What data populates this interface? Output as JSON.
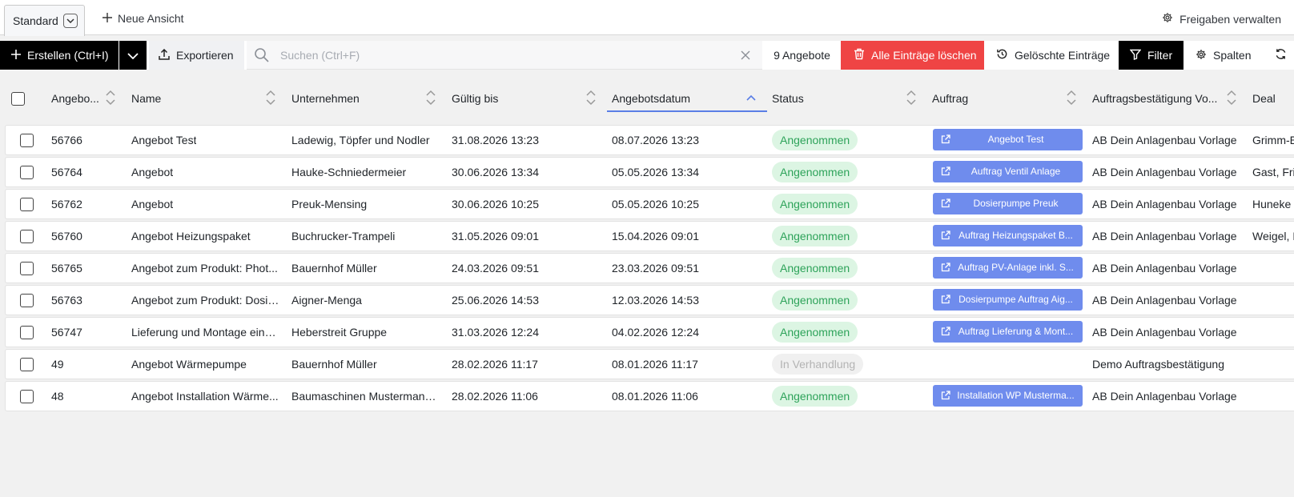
{
  "tabs": {
    "standard_label": "Standard",
    "new_view_label": "Neue Ansicht",
    "shares_label": "Freigaben verwalten"
  },
  "toolbar": {
    "create_label": "Erstellen (Ctrl+I)",
    "export_label": "Exportieren",
    "search_placeholder": "Suchen (Ctrl+F)",
    "search_value": "",
    "count_label": "9 Angebote",
    "delete_all_label": "Alle Einträge löschen",
    "deleted_entries_label": "Gelöschte Einträge",
    "filter_label": "Filter",
    "columns_label": "Spalten"
  },
  "columns": [
    {
      "key": "id",
      "label": "Angebo..."
    },
    {
      "key": "name",
      "label": "Name"
    },
    {
      "key": "company",
      "label": "Unternehmen"
    },
    {
      "key": "valid_until",
      "label": "Gültig bis"
    },
    {
      "key": "offer_date",
      "label": "Angebotsdatum",
      "sort": "asc"
    },
    {
      "key": "status",
      "label": "Status"
    },
    {
      "key": "order",
      "label": "Auftrag"
    },
    {
      "key": "confirmation",
      "label": "Auftragsbestätigung Vo..."
    },
    {
      "key": "deal",
      "label": "Deal"
    }
  ],
  "rows": [
    {
      "id": "56766",
      "name": "Angebot Test",
      "company": "Ladewig, Töpfer und Nodler",
      "valid_until": "31.08.2026 13:23",
      "offer_date": "08.07.2026 13:23",
      "status": "Angenommen",
      "status_type": "accepted",
      "order": "Angebot Test",
      "confirmation": "AB Dein Anlagenbau Vorlage",
      "deal": "Grimm-E"
    },
    {
      "id": "56764",
      "name": "Angebot",
      "company": "Hauke-Schniedermeier",
      "valid_until": "30.06.2026 13:34",
      "offer_date": "05.05.2026 13:34",
      "status": "Angenommen",
      "status_type": "accepted",
      "order": "Auftrag Ventil Anlage",
      "confirmation": "AB Dein Anlagenbau Vorlage",
      "deal": "Gast, Fri"
    },
    {
      "id": "56762",
      "name": "Angebot",
      "company": "Preuk-Mensing",
      "valid_until": "30.06.2026 10:25",
      "offer_date": "05.05.2026 10:25",
      "status": "Angenommen",
      "status_type": "accepted",
      "order": "Dosierpumpe Preuk",
      "confirmation": "AB Dein Anlagenbau Vorlage",
      "deal": "Huneke"
    },
    {
      "id": "56760",
      "name": "Angebot Heizungspaket",
      "company": "Buchrucker-Trampeli",
      "valid_until": "31.05.2026 09:01",
      "offer_date": "15.04.2026 09:01",
      "status": "Angenommen",
      "status_type": "accepted",
      "order": "Auftrag Heizungspaket B...",
      "confirmation": "AB Dein Anlagenbau Vorlage",
      "deal": "Weigel, F"
    },
    {
      "id": "56765",
      "name": "Angebot zum Produkt: Phot...",
      "company": "Bauernhof Müller",
      "valid_until": "24.03.2026 09:51",
      "offer_date": "23.03.2026 09:51",
      "status": "Angenommen",
      "status_type": "accepted",
      "order": "Auftrag PV-Anlage inkl. S...",
      "confirmation": "AB Dein Anlagenbau Vorlage",
      "deal": ""
    },
    {
      "id": "56763",
      "name": "Angebot zum Produkt: Dosie...",
      "company": "Aigner-Menga",
      "valid_until": "25.06.2026 14:53",
      "offer_date": "12.03.2026 14:53",
      "status": "Angenommen",
      "status_type": "accepted",
      "order": "Dosierpumpe Auftrag Aig...",
      "confirmation": "AB Dein Anlagenbau Vorlage",
      "deal": ""
    },
    {
      "id": "56747",
      "name": "Lieferung und Montage eine...",
      "company": "Heberstreit Gruppe",
      "valid_until": "31.03.2026 12:24",
      "offer_date": "04.02.2026 12:24",
      "status": "Angenommen",
      "status_type": "accepted",
      "order": "Auftrag Lieferung & Mont...",
      "confirmation": "AB Dein Anlagenbau Vorlage",
      "deal": ""
    },
    {
      "id": "49",
      "name": "Angebot Wärmepumpe",
      "company": "Bauernhof Müller",
      "valid_until": "28.02.2026 11:17",
      "offer_date": "08.01.2026 11:17",
      "status": "In Verhandlung",
      "status_type": "negotiation",
      "order": "",
      "confirmation": "Demo Auftragsbestätigung",
      "deal": ""
    },
    {
      "id": "48",
      "name": "Angebot Installation Wärme...",
      "company": "Baumaschinen Mustermann ...",
      "valid_until": "28.02.2026 11:06",
      "offer_date": "08.01.2026 11:06",
      "status": "Angenommen",
      "status_type": "accepted",
      "order": "Installation WP Musterma...",
      "confirmation": "AB Dein Anlagenbau Vorlage",
      "deal": ""
    }
  ],
  "colors": {
    "accent": "#5a7ee6",
    "order_button": "#6f8ced",
    "danger": "#ef4444",
    "accepted_bg": "#dcf5e3",
    "accepted_text": "#2ea35a",
    "negotiation_bg": "#f0f0f0",
    "negotiation_text": "#b3b3b3"
  },
  "icons": {
    "new_view": "plus-icon",
    "shares": "gear-icon",
    "create": "plus-icon",
    "create_menu": "chevron-down-icon",
    "export": "upload-icon",
    "search": "search-icon",
    "clear": "close-icon",
    "delete_all": "trash-icon",
    "deleted_entries": "history-icon",
    "filter": "filter-icon",
    "columns": "gear-icon",
    "refresh": "refresh-icon",
    "order_link": "external-link-icon"
  }
}
